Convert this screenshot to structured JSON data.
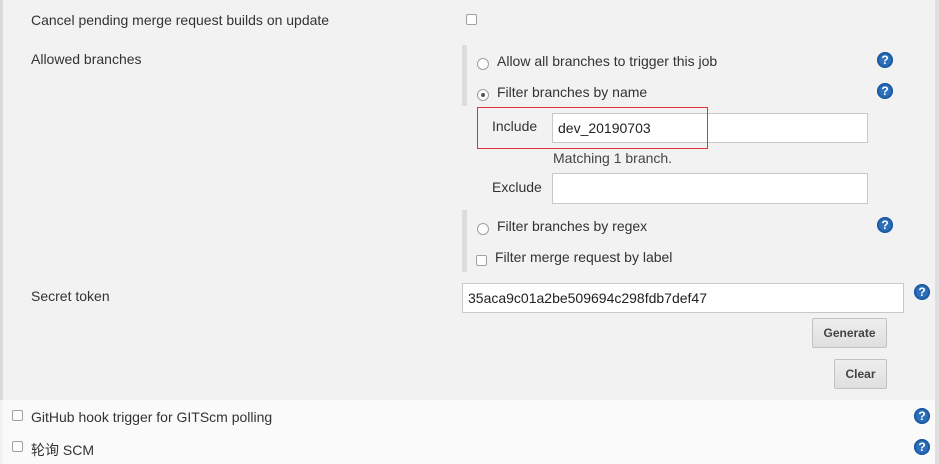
{
  "cancel_pending": {
    "label": "Cancel pending merge request builds on update"
  },
  "allowed_branches": {
    "label": "Allowed branches",
    "options": [
      {
        "label": "Allow all branches to trigger this job"
      },
      {
        "label": "Filter branches by name"
      },
      {
        "label": "Filter branches by regex"
      },
      {
        "label": "Filter merge request by label"
      }
    ],
    "include_label": "Include",
    "include_value": "dev_20190703",
    "matching_text": "Matching 1 branch.",
    "exclude_label": "Exclude",
    "exclude_value": ""
  },
  "secret_token": {
    "label": "Secret token",
    "value": "35aca9c01a2be509694c298fdb7def47",
    "generate_label": "Generate",
    "clear_label": "Clear"
  },
  "github_hook": {
    "label": "GitHub hook trigger for GITScm polling"
  },
  "poll_scm": {
    "label": "轮询 SCM"
  },
  "colors": {
    "help_icon": "#2c6fba",
    "highlight_border": "#e0323a"
  }
}
